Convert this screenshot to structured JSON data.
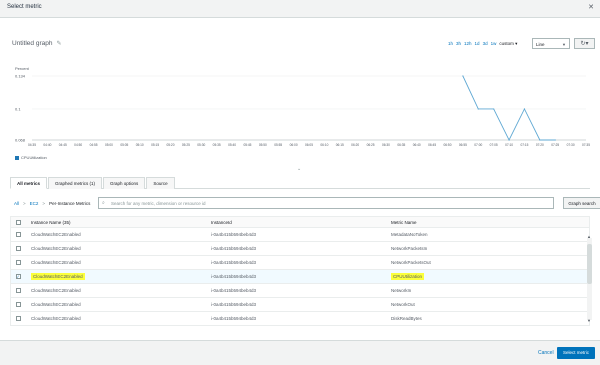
{
  "modal": {
    "title": "Select metric",
    "close": "✕"
  },
  "graph": {
    "title": "Untitled graph",
    "edit_icon": "pencil-icon"
  },
  "time_ranges": [
    "1h",
    "3h",
    "12h",
    "1d",
    "3d",
    "1w"
  ],
  "custom_label": "custom ▾",
  "view_type": {
    "selected": "Line"
  },
  "refresh_icon": "refresh-icon",
  "chart_data": {
    "type": "line",
    "ylabel": "Percent",
    "yticks": [
      "0.134",
      "0.1",
      "0.068"
    ],
    "ylim": [
      0.068,
      0.134
    ],
    "x": [
      "04:35",
      "04:40",
      "04:45",
      "04:50",
      "04:55",
      "05:00",
      "05:05",
      "05:10",
      "05:15",
      "05:20",
      "05:25",
      "05:30",
      "05:35",
      "05:40",
      "05:45",
      "05:50",
      "05:55",
      "06:00",
      "06:05",
      "06:10",
      "06:15",
      "06:20",
      "06:25",
      "06:30",
      "06:35",
      "06:40",
      "06:45",
      "06:50",
      "06:55",
      "07:00",
      "07:05",
      "07:10",
      "07:15",
      "07:20",
      "07:25",
      "07:30",
      "07:35"
    ],
    "series": [
      {
        "name": "CPUUtilization",
        "color": "#1f77b4",
        "points": [
          {
            "x": "06:55",
            "y": 0.134
          },
          {
            "x": "07:00",
            "y": 0.1
          },
          {
            "x": "07:05",
            "y": 0.1
          },
          {
            "x": "07:10",
            "y": 0.068
          },
          {
            "x": "07:15",
            "y": 0.1
          },
          {
            "x": "07:20",
            "y": 0.068
          },
          {
            "x": "07:25",
            "y": 0.068
          }
        ]
      }
    ],
    "grid": true,
    "legend": "bottom-left"
  },
  "tabs": [
    {
      "label": "All metrics",
      "active": true
    },
    {
      "label": "Graphed metrics (1)",
      "active": false
    },
    {
      "label": "Graph options",
      "active": false
    },
    {
      "label": "Source",
      "active": false
    }
  ],
  "breadcrumb": {
    "all": "All",
    "ec2": "EC2",
    "current": "Per-Instance Metrics"
  },
  "search": {
    "placeholder": "Search for any metric, dimension or resource id",
    "value": ""
  },
  "graph_search_label": "Graph search",
  "table": {
    "headers": {
      "name": "Instance Name (35)",
      "id": "InstanceId",
      "metric": "Metric Name"
    },
    "rows": [
      {
        "name": "CloudWatchEC2Enabled",
        "id": "i-0a4b415b594beb4d3",
        "metric": "MetadataNoToken",
        "checked": false
      },
      {
        "name": "CloudWatchEC2Enabled",
        "id": "i-0a4b415b594beb4d3",
        "metric": "NetworkPacketsIn",
        "checked": false
      },
      {
        "name": "CloudWatchEC2Enabled",
        "id": "i-0a4b415b594beb4d3",
        "metric": "NetworkPacketsOut",
        "checked": false
      },
      {
        "name": "CloudWatchEC2Enabled",
        "id": "i-0a4b415b594beb4d3",
        "metric": "CPUUtilization",
        "checked": true
      },
      {
        "name": "CloudWatchEC2Enabled",
        "id": "i-0a4b415b594beb4d3",
        "metric": "NetworkIn",
        "checked": false
      },
      {
        "name": "CloudWatchEC2Enabled",
        "id": "i-0a4b415b594beb4d3",
        "metric": "NetworkOut",
        "checked": false
      },
      {
        "name": "CloudWatchEC2Enabled",
        "id": "i-0a4b415b594beb4d3",
        "metric": "DiskReadBytes",
        "checked": false
      }
    ]
  },
  "footer": {
    "cancel": "Cancel",
    "select": "Select metric"
  }
}
